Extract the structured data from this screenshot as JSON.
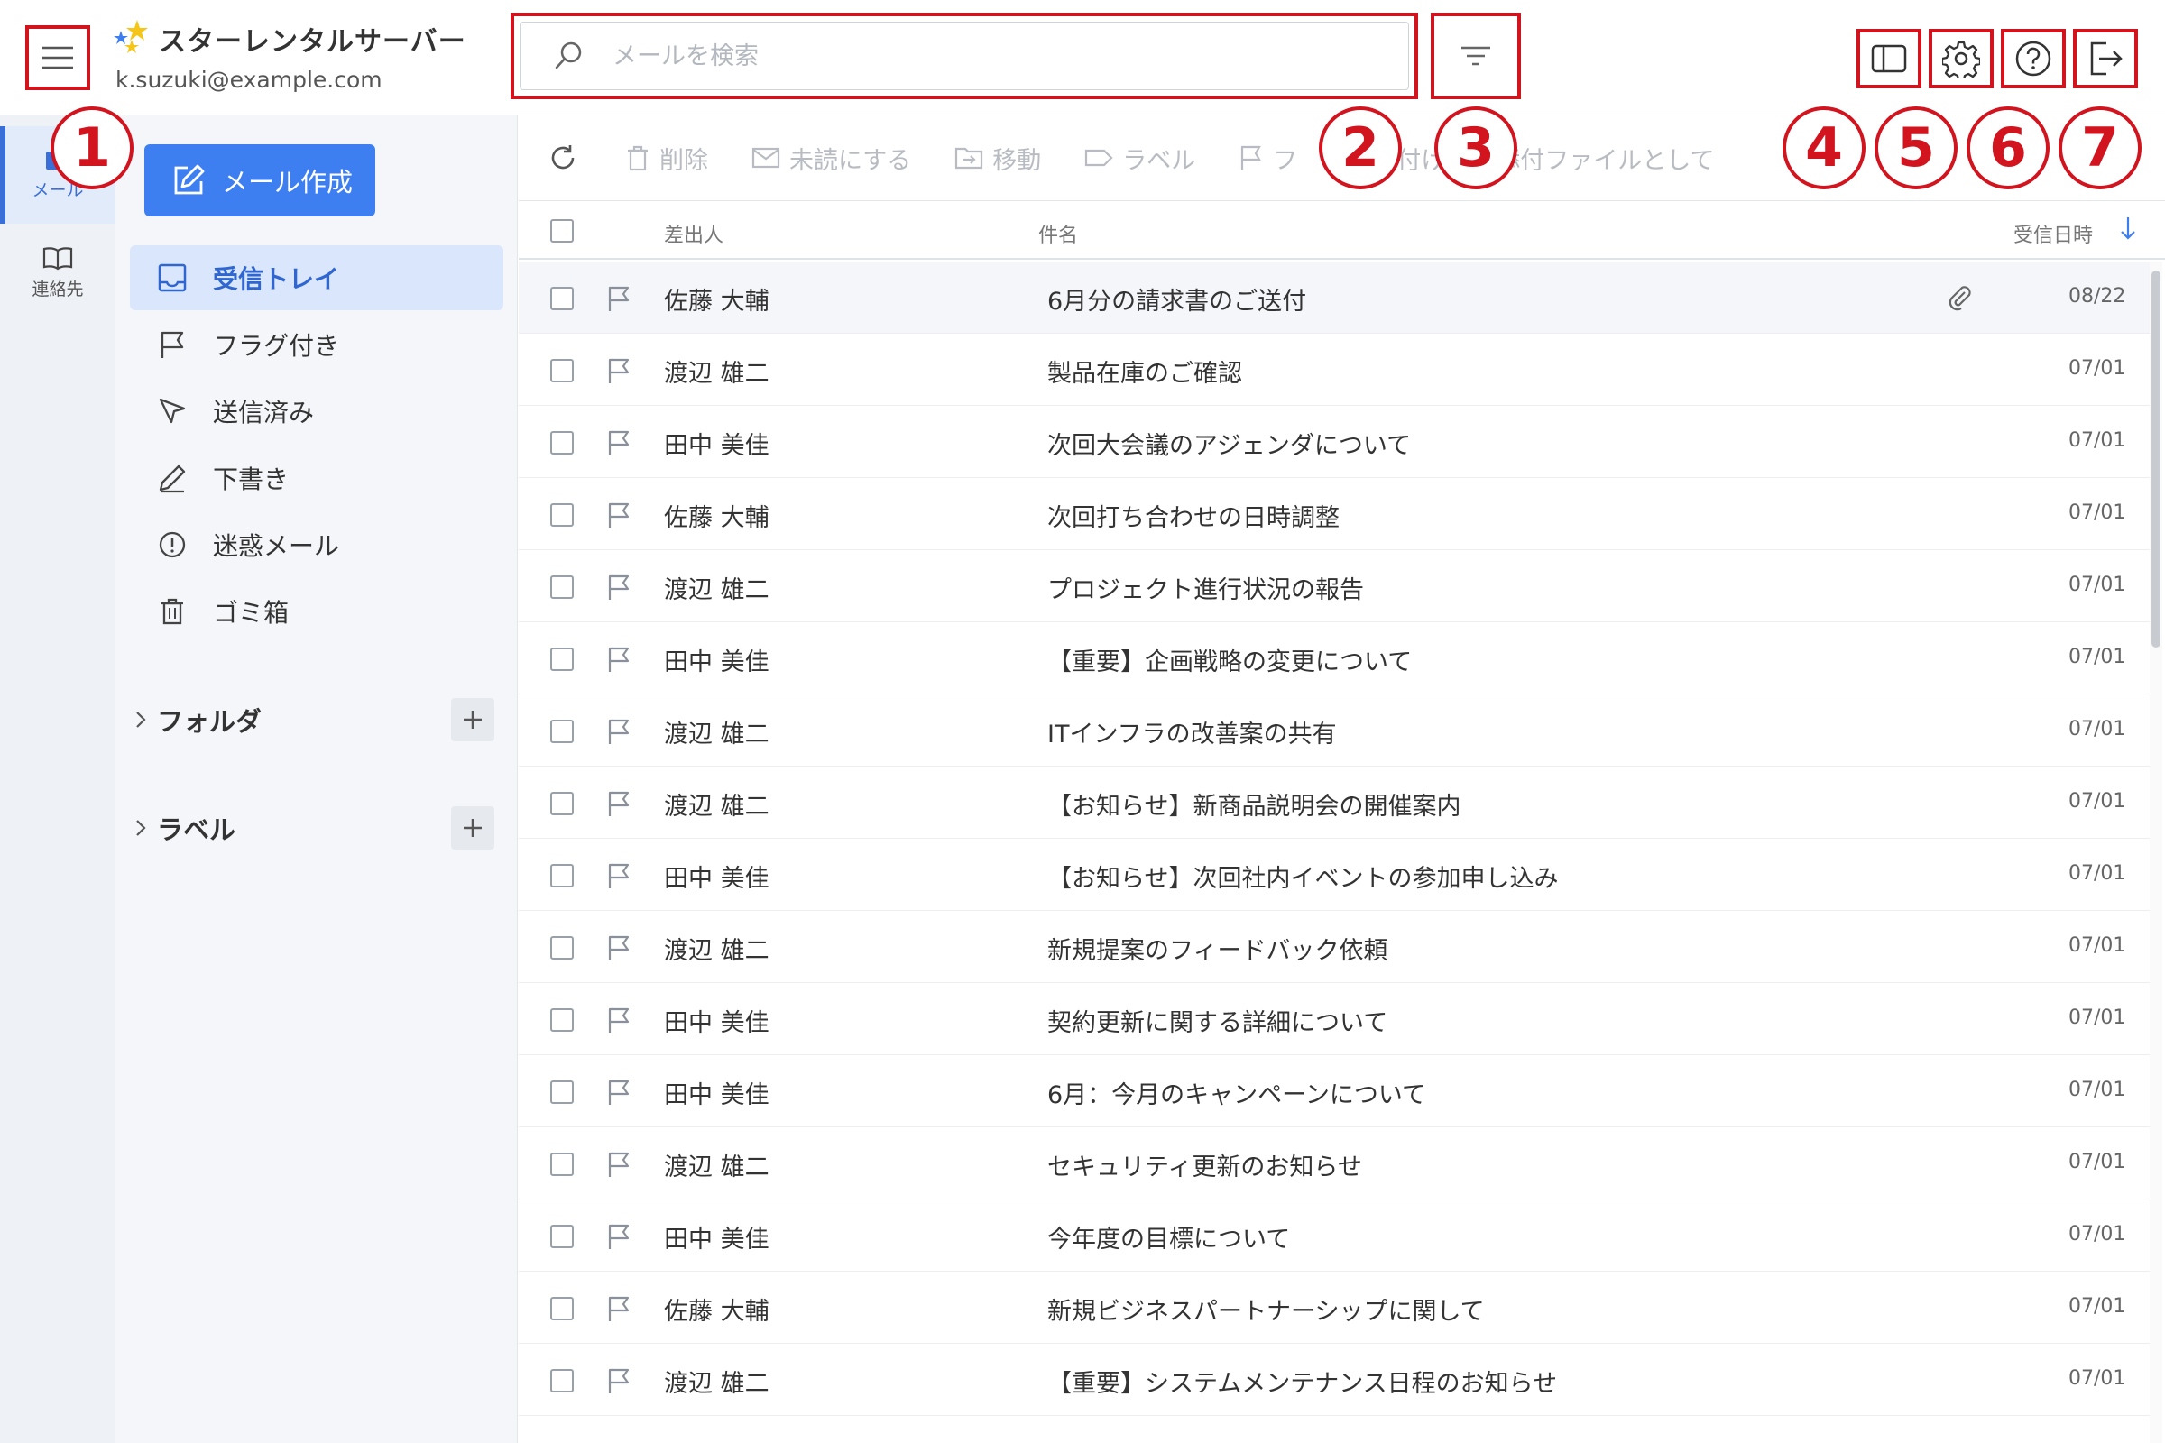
{
  "header": {
    "brand_name": "スターレンタルサーバー",
    "user_email": "k.suzuki@example.com",
    "search_placeholder": "メールを検索"
  },
  "badges": [
    "1",
    "2",
    "3",
    "4",
    "5",
    "6",
    "7"
  ],
  "rail": {
    "items": [
      {
        "label": "メール",
        "icon": "mail-icon",
        "active": true
      },
      {
        "label": "連絡先",
        "icon": "book-icon",
        "active": false
      }
    ]
  },
  "sidebar": {
    "compose_label": "メール作成",
    "items": [
      {
        "label": "受信トレイ",
        "icon": "inbox-icon"
      },
      {
        "label": "フラグ付き",
        "icon": "flag-icon"
      },
      {
        "label": "送信済み",
        "icon": "send-icon"
      },
      {
        "label": "下書き",
        "icon": "pencil-icon"
      },
      {
        "label": "迷惑メール",
        "icon": "alert-icon"
      },
      {
        "label": "ゴミ箱",
        "icon": "trash-icon"
      }
    ],
    "folder_label": "フォルダ",
    "label_label": "ラベル"
  },
  "toolbar": {
    "delete": "削除",
    "mark_unread": "未読にする",
    "move": "移動",
    "label": "ラベル",
    "flag": "フ",
    "flag_tail": "付け",
    "attach": "添付ファイルとして"
  },
  "list_header": {
    "from": "差出人",
    "subject": "件名",
    "date": "受信日時"
  },
  "messages": [
    {
      "from": "佐藤 大輔",
      "subject": "6月分の請求書のご送付",
      "date": "08/22",
      "attachment": true
    },
    {
      "from": "渡辺 雄二",
      "subject": "製品在庫のご確認",
      "date": "07/01"
    },
    {
      "from": "田中 美佳",
      "subject": "次回大会議のアジェンダについて",
      "date": "07/01"
    },
    {
      "from": "佐藤 大輔",
      "subject": "次回打ち合わせの日時調整",
      "date": "07/01"
    },
    {
      "from": "渡辺 雄二",
      "subject": "プロジェクト進行状況の報告",
      "date": "07/01"
    },
    {
      "from": "田中 美佳",
      "subject": "【重要】企画戦略の変更について",
      "date": "07/01"
    },
    {
      "from": "渡辺 雄二",
      "subject": "ITインフラの改善案の共有",
      "date": "07/01"
    },
    {
      "from": "渡辺 雄二",
      "subject": "【お知らせ】新商品説明会の開催案内",
      "date": "07/01"
    },
    {
      "from": "田中 美佳",
      "subject": "【お知らせ】次回社内イベントの参加申し込み",
      "date": "07/01"
    },
    {
      "from": "渡辺 雄二",
      "subject": "新規提案のフィードバック依頼",
      "date": "07/01"
    },
    {
      "from": "田中 美佳",
      "subject": "契約更新に関する詳細について",
      "date": "07/01"
    },
    {
      "from": "田中 美佳",
      "subject": "6月：今月のキャンペーンについて",
      "date": "07/01"
    },
    {
      "from": "渡辺 雄二",
      "subject": "セキュリティ更新のお知らせ",
      "date": "07/01"
    },
    {
      "from": "田中 美佳",
      "subject": "今年度の目標について",
      "date": "07/01"
    },
    {
      "from": "佐藤 大輔",
      "subject": "新規ビジネスパートナーシップに関して",
      "date": "07/01"
    },
    {
      "from": "渡辺 雄二",
      "subject": "【重要】システムメンテナンス日程のお知らせ",
      "date": "07/01"
    }
  ],
  "colors": {
    "accent": "#3d7ef0",
    "annotation": "#d2141f",
    "active_bg": "#d9e6fb"
  }
}
